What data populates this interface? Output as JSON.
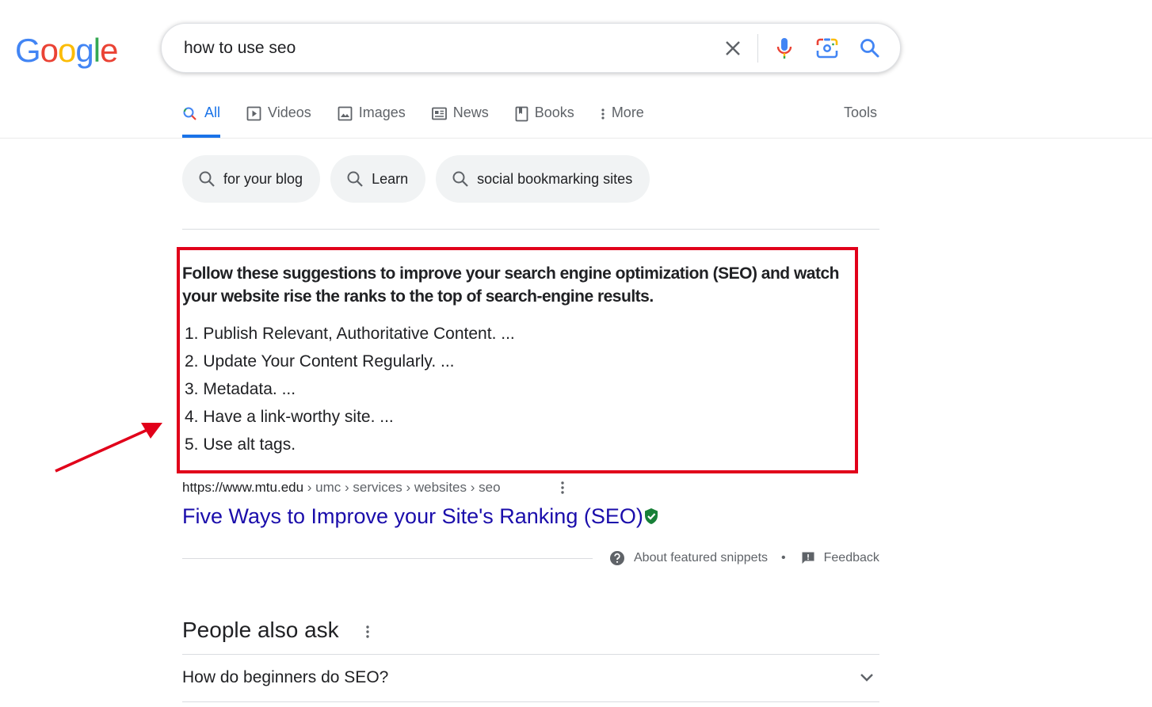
{
  "logo": {
    "letters": [
      "G",
      "o",
      "o",
      "g",
      "l",
      "e"
    ],
    "colors": [
      "#4285f4",
      "#ea4335",
      "#fbbc05",
      "#4285f4",
      "#34a853",
      "#ea4335"
    ]
  },
  "search": {
    "query": "how to use seo",
    "icons": [
      "close-icon",
      "microphone-icon",
      "camera-lens-icon",
      "search-icon"
    ]
  },
  "tabs": [
    {
      "label": "All",
      "icon": "search-icon",
      "active": true
    },
    {
      "label": "Videos",
      "icon": "play-icon",
      "active": false
    },
    {
      "label": "Images",
      "icon": "image-icon",
      "active": false
    },
    {
      "label": "News",
      "icon": "newspaper-icon",
      "active": false
    },
    {
      "label": "Books",
      "icon": "book-icon",
      "active": false
    },
    {
      "label": "More",
      "icon": "more-vertical-icon",
      "active": false
    }
  ],
  "tools_label": "Tools",
  "chips": [
    {
      "label": "for your blog"
    },
    {
      "label": "Learn"
    },
    {
      "label": "social bookmarking sites"
    }
  ],
  "snippet": {
    "lead": "Follow these suggestions to improve your search engine optimization (SEO) and watch your website rise the ranks to the top of search-engine results.",
    "items": [
      "1. Publish Relevant, Authoritative Content. ...",
      "2. Update Your Content Regularly. ...",
      "3. Metadata. ...",
      "4. Have a link-worthy site. ...",
      "5. Use alt tags."
    ],
    "highlight_color": "#e1001a"
  },
  "result": {
    "domain": "https://www.mtu.edu",
    "path": " › umc › services › websites › seo",
    "title": "Five Ways to Improve your Site's Ranking (SEO)",
    "title_color": "#1a0dab"
  },
  "footer": {
    "about_label": "About featured snippets",
    "separator": "•",
    "feedback_label": "Feedback"
  },
  "paa": {
    "title": "People also ask",
    "questions": [
      "How do beginners do SEO?"
    ]
  }
}
